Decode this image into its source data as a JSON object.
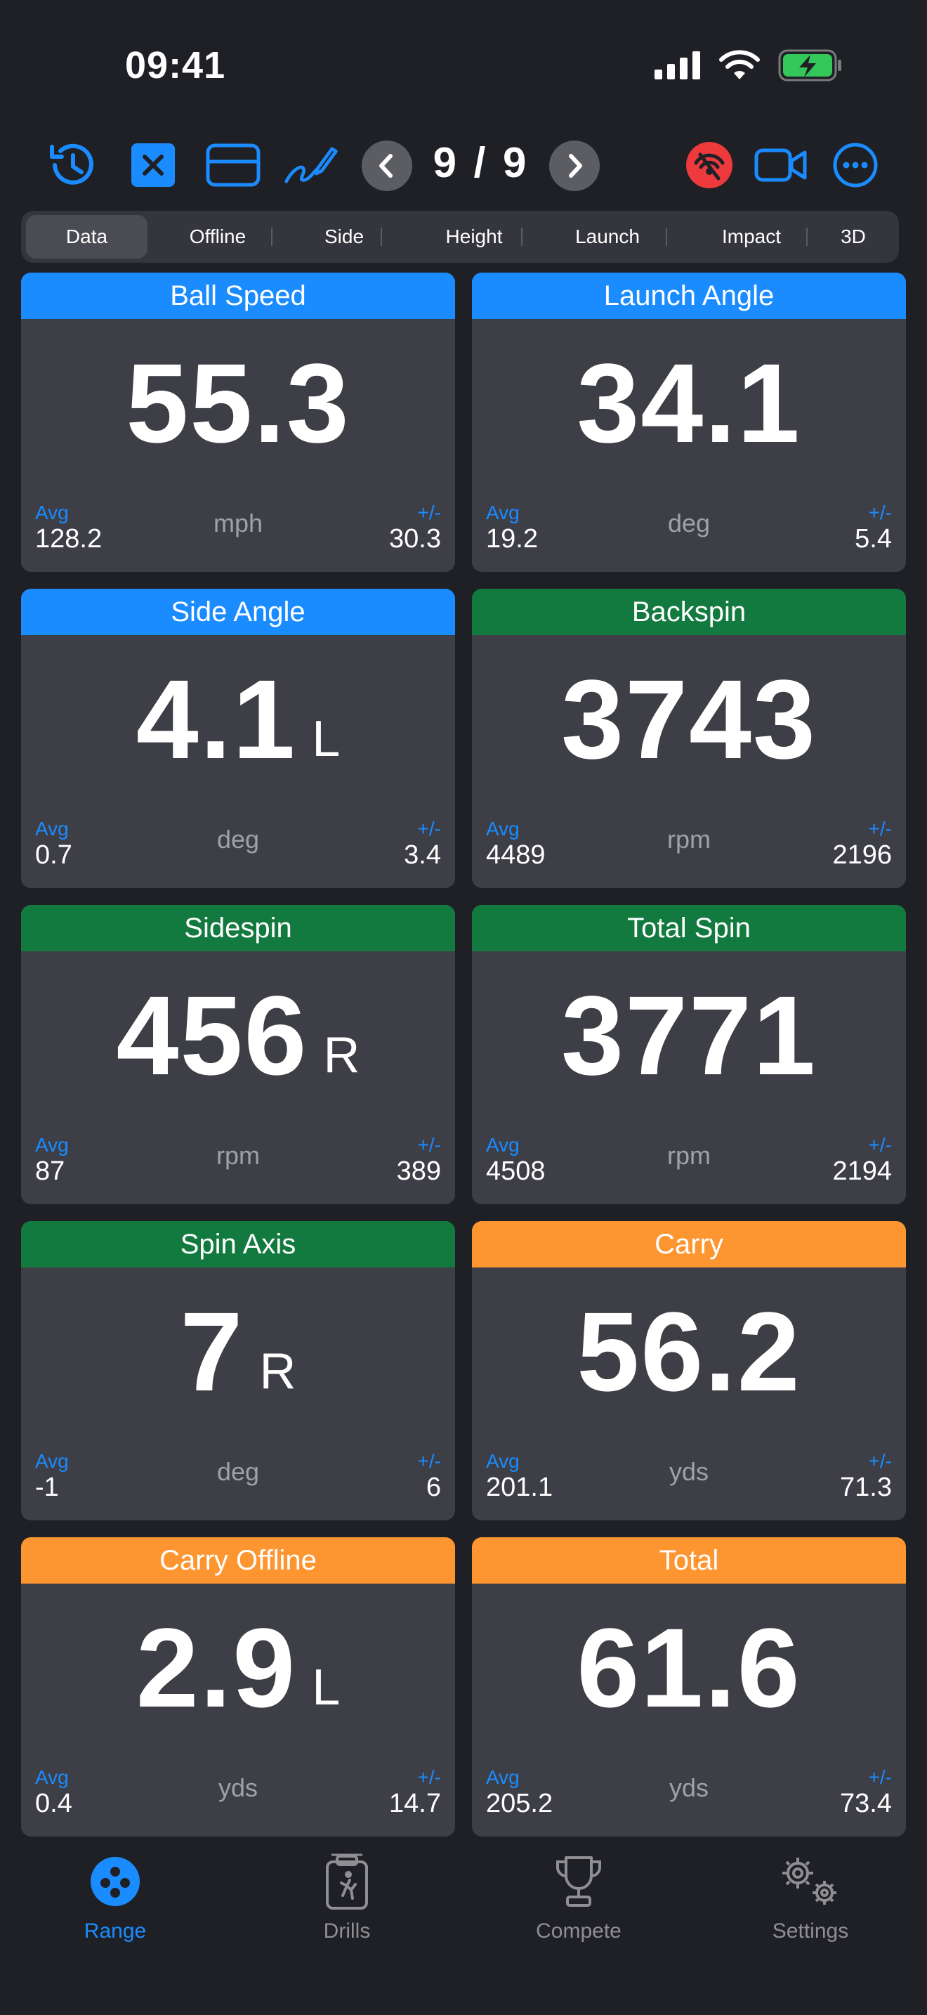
{
  "status": {
    "time": "09:41"
  },
  "toolbar": {
    "counter": "9 / 9"
  },
  "colors": {
    "accent": "#1a8cff",
    "header_blue": "#1a8cff",
    "header_green": "#137a3f",
    "header_orange": "#fd9530",
    "record_red": "#ee3a3c",
    "card_bg": "#3d3e46",
    "muted": "#a0a1a8"
  },
  "segment": {
    "tabs": [
      {
        "label": "Data",
        "active": true
      },
      {
        "label": "Offline"
      },
      {
        "label": "Side"
      },
      {
        "label": "Height"
      },
      {
        "label": "Launch"
      },
      {
        "label": "Impact"
      },
      {
        "label": "3D"
      }
    ]
  },
  "cards": [
    {
      "title": "Ball Speed",
      "value": "55.3",
      "dir": "",
      "unit": "mph",
      "avg_label": "Avg",
      "avg": "128.2",
      "pm_label": "+/-",
      "pm": "30.3",
      "color": "blue"
    },
    {
      "title": "Launch Angle",
      "value": "34.1",
      "dir": "",
      "unit": "deg",
      "avg_label": "Avg",
      "avg": "19.2",
      "pm_label": "+/-",
      "pm": "5.4",
      "color": "blue"
    },
    {
      "title": "Side Angle",
      "value": "4.1",
      "dir": "L",
      "unit": "deg",
      "avg_label": "Avg",
      "avg": "0.7",
      "pm_label": "+/-",
      "pm": "3.4",
      "color": "blue"
    },
    {
      "title": "Backspin",
      "value": "3743",
      "dir": "",
      "unit": "rpm",
      "avg_label": "Avg",
      "avg": "4489",
      "pm_label": "+/-",
      "pm": "2196",
      "color": "green"
    },
    {
      "title": "Sidespin",
      "value": "456",
      "dir": "R",
      "unit": "rpm",
      "avg_label": "Avg",
      "avg": "87",
      "pm_label": "+/-",
      "pm": "389",
      "color": "green"
    },
    {
      "title": "Total Spin",
      "value": "3771",
      "dir": "",
      "unit": "rpm",
      "avg_label": "Avg",
      "avg": "4508",
      "pm_label": "+/-",
      "pm": "2194",
      "color": "green"
    },
    {
      "title": "Spin Axis",
      "value": "7",
      "dir": "R",
      "unit": "deg",
      "avg_label": "Avg",
      "avg": "-1",
      "pm_label": "+/-",
      "pm": "6",
      "color": "green"
    },
    {
      "title": "Carry",
      "value": "56.2",
      "dir": "",
      "unit": "yds",
      "avg_label": "Avg",
      "avg": "201.1",
      "pm_label": "+/-",
      "pm": "71.3",
      "color": "orange"
    },
    {
      "title": "Carry Offline",
      "value": "2.9",
      "dir": "L",
      "unit": "yds",
      "avg_label": "Avg",
      "avg": "0.4",
      "pm_label": "+/-",
      "pm": "14.7",
      "color": "orange"
    },
    {
      "title": "Total",
      "value": "61.6",
      "dir": "",
      "unit": "yds",
      "avg_label": "Avg",
      "avg": "205.2",
      "pm_label": "+/-",
      "pm": "73.4",
      "color": "orange"
    }
  ],
  "tabbar": {
    "items": [
      {
        "label": "Range",
        "icon": "range-icon",
        "active": true
      },
      {
        "label": "Drills",
        "icon": "drills-icon"
      },
      {
        "label": "Compete",
        "icon": "trophy-icon"
      },
      {
        "label": "Settings",
        "icon": "gears-icon"
      }
    ]
  }
}
